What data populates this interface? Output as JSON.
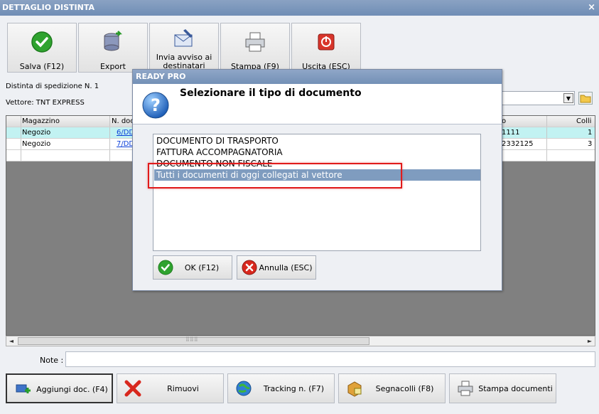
{
  "window": {
    "title": "DETTAGLIO DISTINTA",
    "close_glyph": "×"
  },
  "toolbar": {
    "save": "Salva (F12)",
    "export": "Export",
    "notify": "Invia avviso ai destinatari",
    "print": "Stampa (F9)",
    "exit": "Uscita (ESC)"
  },
  "info": {
    "distinta": "Distinta di spedizione N. 1",
    "vettore": "Vettore: TNT EXPRESS"
  },
  "grid": {
    "headers": {
      "magazzino": "Magazzino",
      "ndoc": "N. doc",
      "tracking": "o",
      "colli": "Colli"
    },
    "rows": [
      {
        "magazzino": "Negozio",
        "ndoc": "6/DD",
        "tracking": "1111",
        "colli": "1"
      },
      {
        "magazzino": "Negozio",
        "ndoc": "7/DD",
        "tracking": "2332125",
        "colli": "3"
      }
    ]
  },
  "scrollbar": {
    "left_arrow": "◄",
    "right_arrow": "►",
    "grip": "⠿⠿⠿"
  },
  "note": {
    "label": "Note :",
    "value": ""
  },
  "bottom": {
    "add": "Aggiungi doc. (F4)",
    "remove": "Rimuovi",
    "tracking": "Tracking n. (F7)",
    "labels": "Segnacolli (F8)",
    "print_docs": "Stampa documenti"
  },
  "dialog": {
    "title": "READY PRO",
    "heading": "Selezionare il tipo di documento",
    "items": [
      "DOCUMENTO DI TRASPORTO",
      "FATTURA ACCOMPAGNATORIA",
      "DOCUMENTO NON FISCALE",
      "Tutti i documenti di oggi collegati al vettore"
    ],
    "selected_index": 3,
    "ok": "OK (F12)",
    "cancel": "Annulla (ESC)"
  },
  "colors": {
    "title_bar": "#7390b6",
    "selected_row": "#c2f2f2",
    "list_selection": "#7f9cbf",
    "highlight_box": "#e11b1b"
  }
}
